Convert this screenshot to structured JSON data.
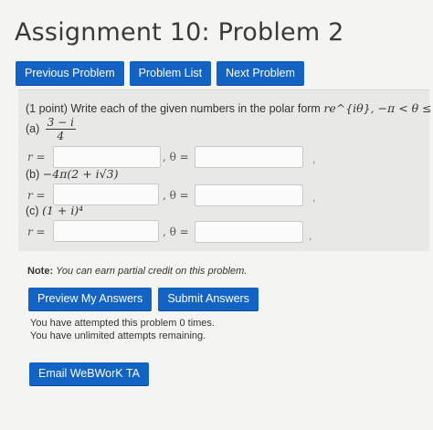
{
  "page": {
    "title": "Assignment 10: Problem 2"
  },
  "nav": {
    "previous": "Previous Problem",
    "list": "Problem List",
    "next": "Next Problem"
  },
  "problem": {
    "points": "(1 point) Write each of the given numbers in the polar form",
    "form": "re^{iθ}, −π < θ ≤ π.",
    "parts": [
      {
        "label": "(a)",
        "expr_num": "3 − i",
        "expr_den": "4"
      },
      {
        "label": "(b)",
        "expr": "−4π(2 + i√3)"
      },
      {
        "label": "(c)",
        "expr": "(1 + i)⁴"
      }
    ],
    "r_label": "r =",
    "theta_label": ", θ =",
    "comma": ","
  },
  "note": {
    "bold": "Note:",
    "text": "You can earn partial credit on this problem."
  },
  "actions": {
    "preview": "Preview My Answers",
    "submit": "Submit Answers",
    "email": "Email WeBWorK TA"
  },
  "status": {
    "attempts": "You have attempted this problem 0 times.",
    "remaining": "You have unlimited attempts remaining."
  }
}
